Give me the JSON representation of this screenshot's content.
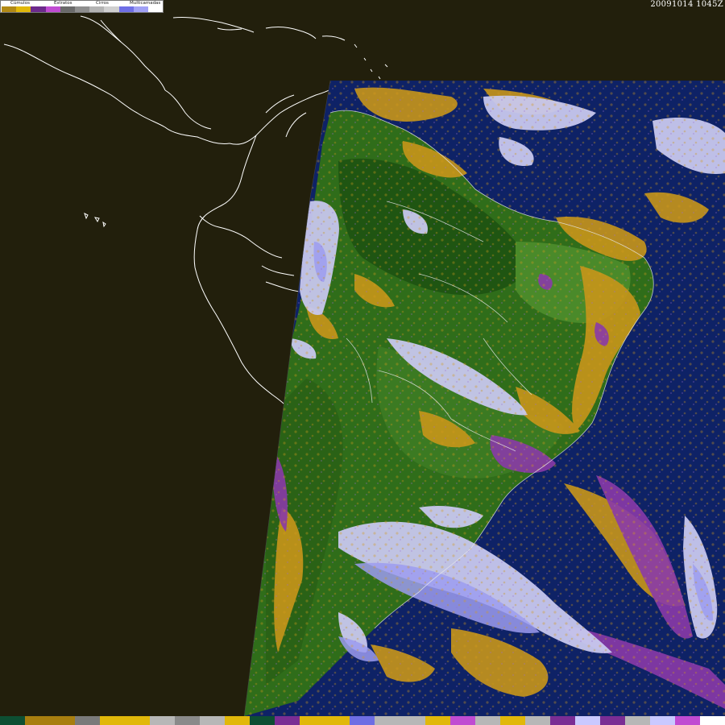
{
  "timestamp": "20091014 1045Z",
  "legend": {
    "labels": {
      "cumulos": "Cúmulos",
      "estratos": "Estratos",
      "cirros": "Cirros",
      "multicamadas": "Multicamadas"
    },
    "swatches": [
      "#b28a15",
      "#e1b80a",
      "#6d2a8c",
      "#c04bd2",
      "#6a6a6a",
      "#8e8e8e",
      "#b3b3b3",
      "#d0d0d0",
      "#6f6fe6",
      "#a0a0f5",
      "#ffffff"
    ]
  },
  "palette": [
    "#0d4f33",
    "#a87e0f",
    "#a87e0f",
    "#7a7a7a",
    "#e1b80a",
    "#e1b80a",
    "#b7b7b7",
    "#8a8a8a",
    "#b7b7b7",
    "#e1b80a",
    "#0d4f33",
    "#7a2d94",
    "#e1b80a",
    "#e1b80a",
    "#6e6ee4",
    "#b7b7b7",
    "#b7b7b7",
    "#e1b80a",
    "#c04bd2",
    "#b7b7b7",
    "#e1b80a",
    "#b7b7b7",
    "#7a2d94",
    "#c9c9ff",
    "#7a2d94",
    "#b7b7b7",
    "#c9c9ff",
    "#c04bd2",
    "#ffffff"
  ],
  "colors": {
    "background": "#221f0c",
    "ocean": "#0e2266",
    "vegetation": "#2d6a18",
    "dark_vegetation": "#1f5512",
    "cumulus": "#c8961a",
    "stratus": "#8a3aa8",
    "cirrus": "#c8c8ee",
    "multilayer": "#9c9cf0",
    "coastline": "#ffffff"
  }
}
